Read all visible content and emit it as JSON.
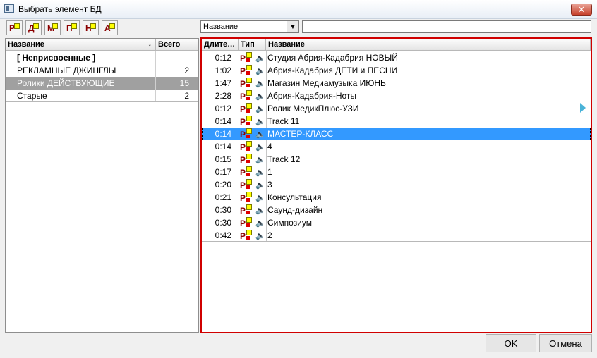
{
  "window": {
    "title": "Выбрать элемент БД",
    "close_symbol": "✕"
  },
  "toolbar": {
    "buttons": [
      {
        "letter": "Р",
        "icon": "category-r-icon"
      },
      {
        "letter": "Д",
        "icon": "category-d-icon"
      },
      {
        "letter": "М",
        "icon": "category-m-icon"
      },
      {
        "letter": "П",
        "icon": "category-p-icon"
      },
      {
        "letter": "Н",
        "icon": "category-n-icon"
      },
      {
        "letter": "А",
        "icon": "category-a-icon"
      }
    ],
    "field_select": {
      "value": "Название",
      "arrow": "▼"
    },
    "search": {
      "value": "",
      "placeholder": ""
    }
  },
  "categories": {
    "headers": {
      "name": "Название",
      "total": "Всего",
      "sort_symbol": "↓"
    },
    "rows": [
      {
        "name": "[ Неприсвоенные ]",
        "count": ""
      },
      {
        "name": "РЕКЛАМНЫЕ ДЖИНГЛЫ",
        "count": "2"
      },
      {
        "name": "Ролики ДЕЙСТВУЮЩИЕ",
        "count": "15"
      },
      {
        "name": "Старые",
        "count": "2"
      }
    ],
    "selected_index": 2
  },
  "tracks": {
    "headers": {
      "duration": "Длите…",
      "type": "Тип",
      "name": "Название"
    },
    "type_letter": "Р",
    "speaker_glyph": "🔈",
    "rows": [
      {
        "duration": "0:12",
        "name": "Студия Абрия-Кадабрия НОВЫЙ"
      },
      {
        "duration": "1:02",
        "name": "Абрия-Кадабрия ДЕТИ и ПЕСНИ"
      },
      {
        "duration": "1:47",
        "name": "Магазин Медиамузыка ИЮНЬ"
      },
      {
        "duration": "2:28",
        "name": "Абрия-Кадабрия-Ноты"
      },
      {
        "duration": "0:12",
        "name": "Ролик МедикПлюс-УЗИ"
      },
      {
        "duration": "0:14",
        "name": "Track 11"
      },
      {
        "duration": "0:14",
        "name": "МАСТЕР-КЛАСС"
      },
      {
        "duration": "0:14",
        "name": "4"
      },
      {
        "duration": "0:15",
        "name": "Track 12"
      },
      {
        "duration": "0:17",
        "name": "1"
      },
      {
        "duration": "0:20",
        "name": "3"
      },
      {
        "duration": "0:21",
        "name": "Консультация"
      },
      {
        "duration": "0:30",
        "name": "Саунд-дизайн"
      },
      {
        "duration": "0:30",
        "name": "Симпозиум"
      },
      {
        "duration": "0:42",
        "name": "2"
      }
    ],
    "selected_index": 6
  },
  "footer": {
    "ok_label": "OK",
    "cancel_label": "Отмена"
  },
  "colors": {
    "selection": "#3399ff",
    "highlight_border": "#d00000",
    "inactive_selection": "#a0a0a0"
  }
}
